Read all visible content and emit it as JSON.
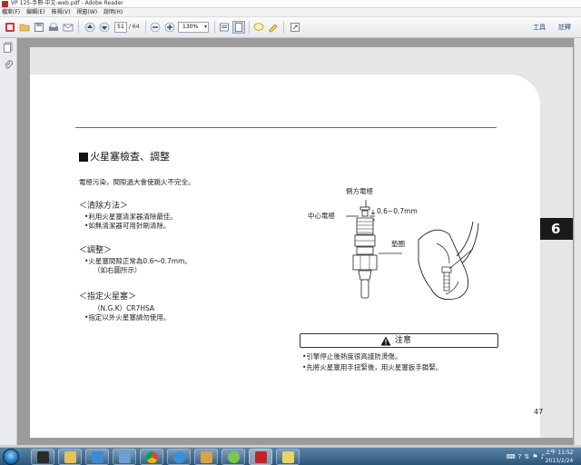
{
  "window": {
    "title": "VP 125-手冊-中文-web.pdf - Adobe Reader"
  },
  "menubar": {
    "items": [
      "檔案(F)",
      "編輯(E)",
      "檢視(V)",
      "視窗(W)",
      "說明(H)"
    ]
  },
  "toolbar": {
    "page_current": "51",
    "page_total": "/ 64",
    "zoom": "130%",
    "tools_label": "工具",
    "comment_label": "註釋"
  },
  "document": {
    "section_title": "火星塞檢查、調整",
    "intro": "電極污染，間隙過大會使跳火不完全。",
    "clean": {
      "heading": "＜清除方法＞",
      "items": [
        "•利用火星塞清潔器清除最佳。",
        "•如無清潔器可用針刷清除。"
      ]
    },
    "adjust": {
      "heading": "＜調整＞",
      "items": [
        "•火星塞間隙正常為0.6～0.7mm。"
      ],
      "note": "（如右圖所示）"
    },
    "specified": {
      "heading": "＜指定火星塞＞",
      "model": "（N.G.K）CR7HSA",
      "items": [
        "•指定以外火星塞請勿使用。"
      ]
    },
    "diagram": {
      "side_electrode": "側方電極",
      "center_electrode": "中心電極",
      "gap": "0.6~0.7mm",
      "washer": "墊圈"
    },
    "caution": {
      "label": "注意",
      "items": [
        "•引擎停止後熱度很高謹防燙傷。",
        "•先將火星塞用手扭緊後，用火星塞扳手鎖緊。"
      ]
    },
    "chapter_tab": "6",
    "page_number": "47"
  },
  "taskbar": {
    "time": "上午 11:52",
    "date": "2013/2/24"
  }
}
